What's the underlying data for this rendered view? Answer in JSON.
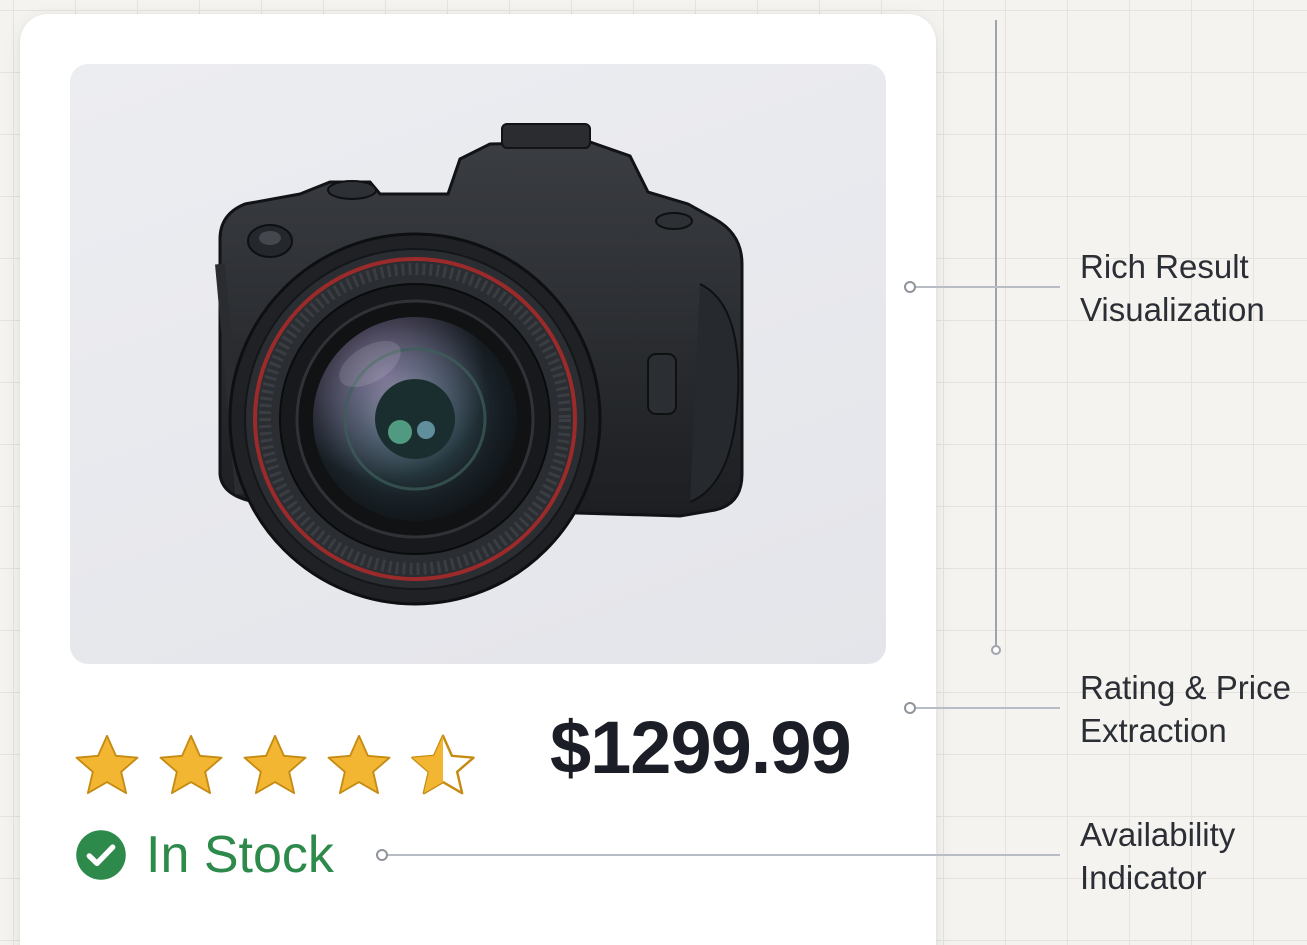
{
  "product": {
    "image_alt": "camera",
    "rating": 4.5,
    "rating_max": 5,
    "price": "$1299.99",
    "availability": "In Stock"
  },
  "callouts": [
    {
      "line1": "Rich Result",
      "line2": "Visualization"
    },
    {
      "line1": "Rating & Price",
      "line2": "Extraction"
    },
    {
      "line1": "Availability",
      "line2": "Indicator"
    }
  ],
  "icons": {
    "star": "star-icon",
    "check": "check-circle-icon"
  },
  "colors": {
    "star": "#f2b632",
    "star_outline": "#c58b12",
    "price": "#1b1e26",
    "in_stock": "#2d8a4b",
    "callout_line": "#b8bcc4"
  }
}
